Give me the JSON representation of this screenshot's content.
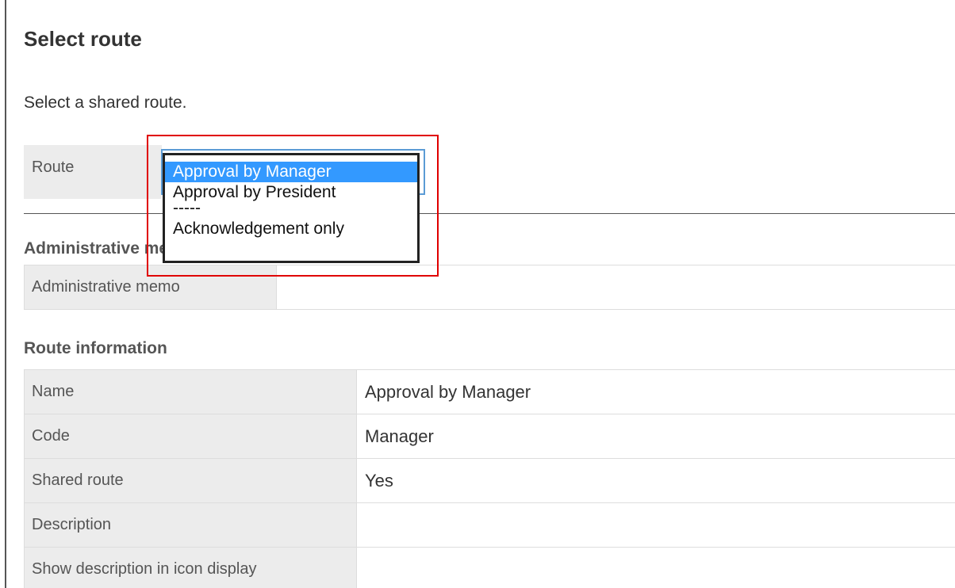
{
  "page": {
    "title": "Select route",
    "instruction": "Select a shared route."
  },
  "route_selector": {
    "label": "Route",
    "selected_value": "Approval by Manager",
    "options": [
      "Approval by Manager",
      "Approval by President",
      "-----",
      "Acknowledgement only"
    ]
  },
  "admin_section": {
    "heading": "Administrative memo",
    "rows": [
      {
        "label": "Administrative memo",
        "value": ""
      }
    ]
  },
  "route_info": {
    "heading": "Route information",
    "rows": [
      {
        "label": "Name",
        "value": "Approval by Manager"
      },
      {
        "label": "Code",
        "value": "Manager"
      },
      {
        "label": "Shared route",
        "value": "Yes"
      },
      {
        "label": "Description",
        "value": ""
      },
      {
        "label": "Show description in icon display",
        "value": ""
      }
    ]
  },
  "colors": {
    "highlight": "#e00000",
    "selected_option": "#3399ff",
    "focus_ring": "#5b9bd5",
    "label_background": "#ececec"
  }
}
